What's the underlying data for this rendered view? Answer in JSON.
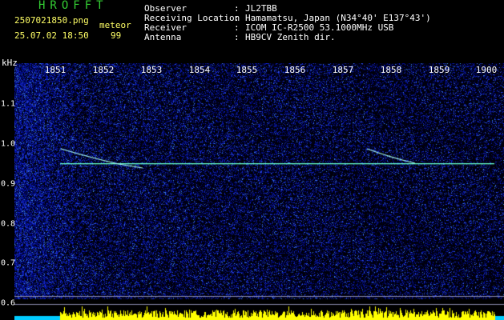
{
  "header": {
    "app_title": "HROFFT",
    "filename": "2507021850.png",
    "mode": "meteor",
    "datetime": "25.07.02 18:50",
    "count": "99"
  },
  "info": [
    {
      "label": "Observer",
      "value": "JL2TBB"
    },
    {
      "label": "Receiving Location",
      "value": "Hamamatsu, Japan (N34°40' E137°43')"
    },
    {
      "label": "Receiver",
      "value": "ICOM IC-R2500 53.1000MHz USB"
    },
    {
      "label": "Antenna",
      "value": "HB9CV Zenith dir."
    }
  ],
  "axes": {
    "y_unit": "kHz",
    "x_ticks": [
      "1851",
      "1852",
      "1853",
      "1854",
      "1855",
      "1856",
      "1857",
      "1858",
      "1859",
      "1900"
    ],
    "y_ticks": [
      "1.1",
      "1.0",
      "0.9",
      "0.8",
      "0.7",
      "0.6"
    ]
  },
  "colors": {
    "background": "#000000",
    "noise_dark": "#000a6e",
    "noise_light": "#3a4fe0",
    "carrier": "#66ffcc",
    "meteor": "#aaffee",
    "bars": "#ffff00",
    "bar_base": "#00ccff",
    "text": "#ffffff",
    "title": "#33cc33"
  }
}
